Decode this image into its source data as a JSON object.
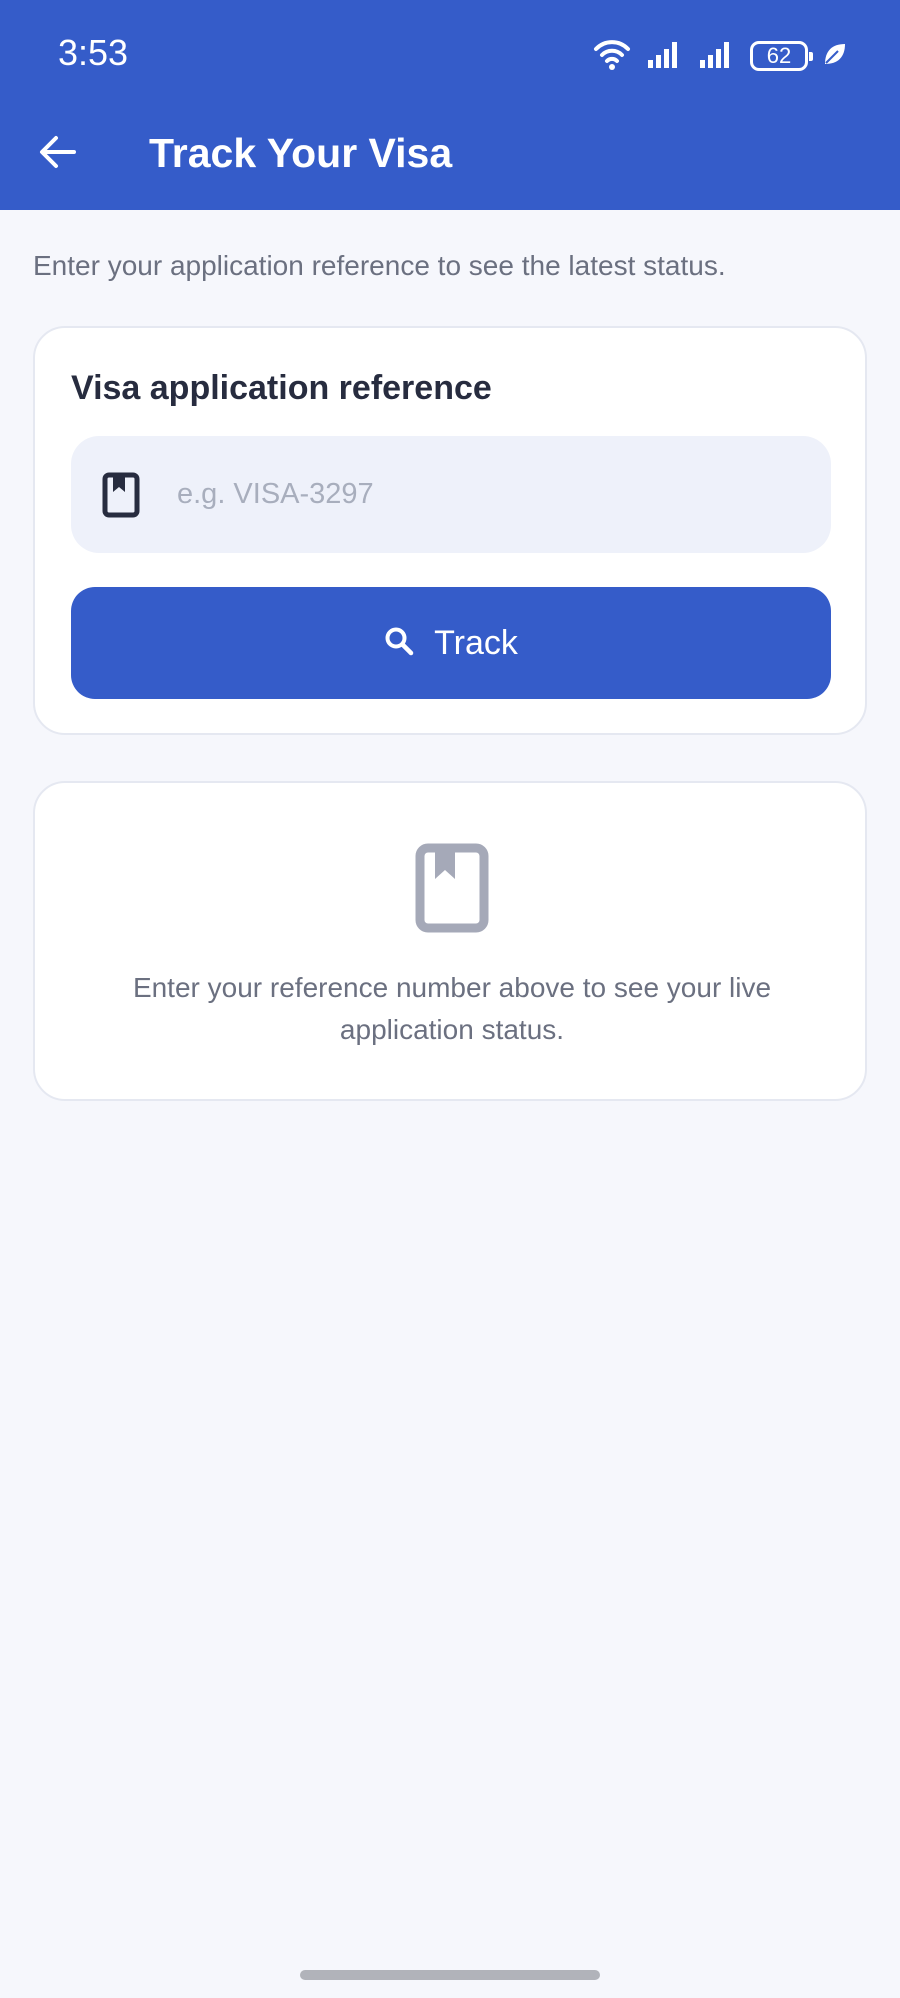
{
  "status_bar": {
    "time": "3:53",
    "battery_level": "62",
    "icons": [
      "wifi-icon",
      "signal-icon",
      "signal-icon",
      "battery-icon",
      "leaf-icon"
    ]
  },
  "header": {
    "back_icon": "arrow-left-icon",
    "title": "Track Your Visa",
    "background_color": "#355cc9"
  },
  "intro_text": "Enter your application reference to see the latest status.",
  "form": {
    "label": "Visa application reference",
    "input_icon": "bookmark-book-icon",
    "input_value": "",
    "input_placeholder": "e.g. VISA-3297",
    "track_button": {
      "icon": "search-icon",
      "label": "Track"
    }
  },
  "empty_state": {
    "icon": "bookmark-book-icon",
    "message": "Enter your reference number above to see your live application status."
  },
  "colors": {
    "accent": "#355cc9",
    "background": "#f6f7fc",
    "input_background": "#eef1fa",
    "muted_text": "#6b7080",
    "heading_text": "#272c3f"
  }
}
